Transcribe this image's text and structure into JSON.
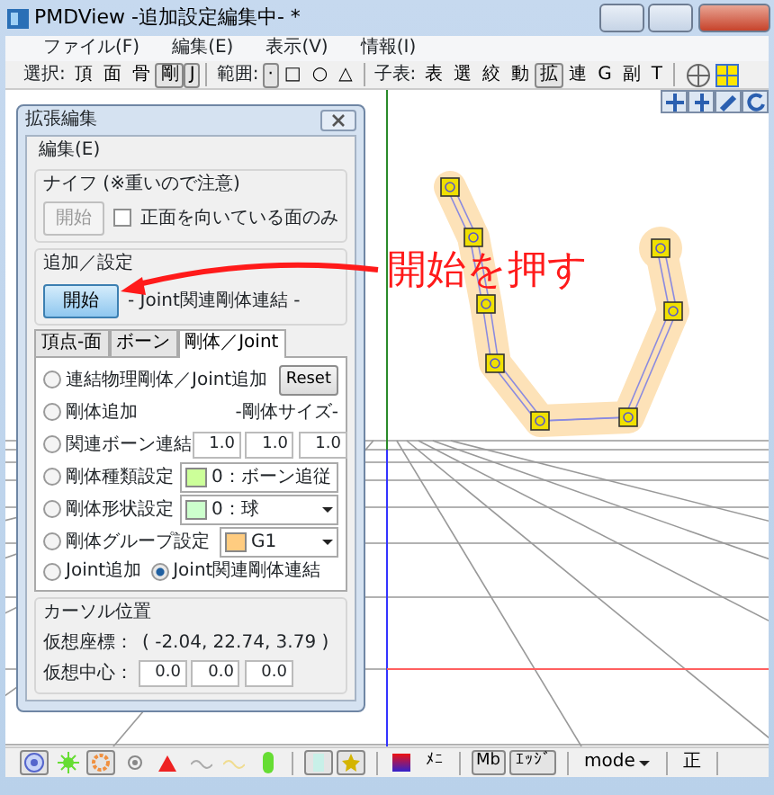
{
  "window": {
    "title": "PMDView -追加設定編集中- *"
  },
  "menu": [
    "ファイル(F)",
    "編集(E)",
    "表示(V)",
    "情報(I)"
  ],
  "toolbar": {
    "groups": [
      {
        "label": "選択:",
        "buttons": [
          {
            "label": "頂",
            "selected": false
          },
          {
            "label": "面",
            "selected": false
          },
          {
            "label": "骨",
            "selected": false
          },
          {
            "label": "剛",
            "selected": true
          },
          {
            "label": "J",
            "selected": true
          }
        ]
      },
      {
        "label": "範囲:",
        "buttons": [
          {
            "label": "·",
            "selected": true
          },
          {
            "label": "□",
            "selected": false
          },
          {
            "label": "○",
            "selected": false
          },
          {
            "label": "△",
            "selected": false
          }
        ]
      },
      {
        "label": "子表:",
        "buttons": [
          {
            "label": "表",
            "selected": false
          },
          {
            "label": "選",
            "selected": false
          },
          {
            "label": "絞",
            "selected": false
          },
          {
            "label": "動",
            "selected": false
          },
          {
            "label": "拡",
            "selected": true
          },
          {
            "label": "連",
            "selected": false
          },
          {
            "label": "G",
            "selected": false
          },
          {
            "label": "副",
            "selected": false
          },
          {
            "label": "T",
            "selected": false
          }
        ]
      }
    ]
  },
  "annotation": {
    "text": "開始を押す"
  },
  "dialog": {
    "title": "拡張編集",
    "menu": "編集(E)",
    "knife": {
      "title": "ナイフ (※重いので注意)",
      "button": "開始",
      "button_disabled": true,
      "checkbox": {
        "label": "正面を向いている面のみ",
        "checked": false
      }
    },
    "add": {
      "title": "追加／設定",
      "button": "開始",
      "mode_label": "- Joint関連剛体連結 -"
    },
    "tabs": [
      {
        "label": "頂点-面",
        "selected": false
      },
      {
        "label": "ボーン",
        "selected": false
      },
      {
        "label": "剛体／Joint",
        "selected": true
      }
    ],
    "options": [
      {
        "label": "連結物理剛体／Joint追加",
        "selected": false
      },
      {
        "label": "剛体追加",
        "selected": false
      },
      {
        "label": "関連ボーン連結",
        "selected": false
      },
      {
        "label": "剛体種類設定",
        "selected": false
      },
      {
        "label": "剛体形状設定",
        "selected": false
      },
      {
        "label": "剛体グループ設定",
        "selected": false
      }
    ],
    "reset": "Reset",
    "size_label": "-剛体サイズ-",
    "sizes": [
      "1.0",
      "1.0",
      "1.0"
    ],
    "selects": [
      {
        "color": "#ccff99",
        "value": "0：ボーン追従"
      },
      {
        "color": "#ccffcc",
        "value": "0：球"
      },
      {
        "color": "#ffcc80",
        "value": "G1"
      }
    ],
    "joint_options": [
      {
        "label": "Joint追加",
        "selected": false
      },
      {
        "label": "Joint関連剛体連結",
        "selected": true
      }
    ],
    "cursor": {
      "title": "カーソル位置",
      "coord_label": "仮想座標：",
      "coord_value": "( -2.04, 22.74, 3.79 )",
      "center_label": "仮想中心：",
      "center": [
        "0.0",
        "0.0",
        "0.0"
      ]
    }
  },
  "bottom_toolbar": {
    "items": [
      {
        "kind": "target",
        "selected": true
      },
      {
        "kind": "sun",
        "selected": false
      },
      {
        "kind": "gear",
        "selected": true
      },
      {
        "kind": "eye",
        "selected": false
      },
      {
        "kind": "triangle",
        "selected": false
      },
      {
        "kind": "wave",
        "selected": false
      },
      {
        "kind": "wave-faint",
        "selected": false
      },
      {
        "kind": "capsule",
        "selected": false
      },
      {
        "kind": "block",
        "selected": true
      },
      {
        "kind": "star-block",
        "selected": true
      },
      {
        "kind": "gradient",
        "selected": false
      },
      {
        "kind": "text",
        "label": "ﾒﾆ",
        "selected": false
      },
      {
        "kind": "text",
        "label": "Mb",
        "selected": true
      },
      {
        "kind": "text",
        "label": "ｴｯｼﾞ",
        "selected": true
      }
    ],
    "mode": "mode",
    "extra": "正"
  }
}
